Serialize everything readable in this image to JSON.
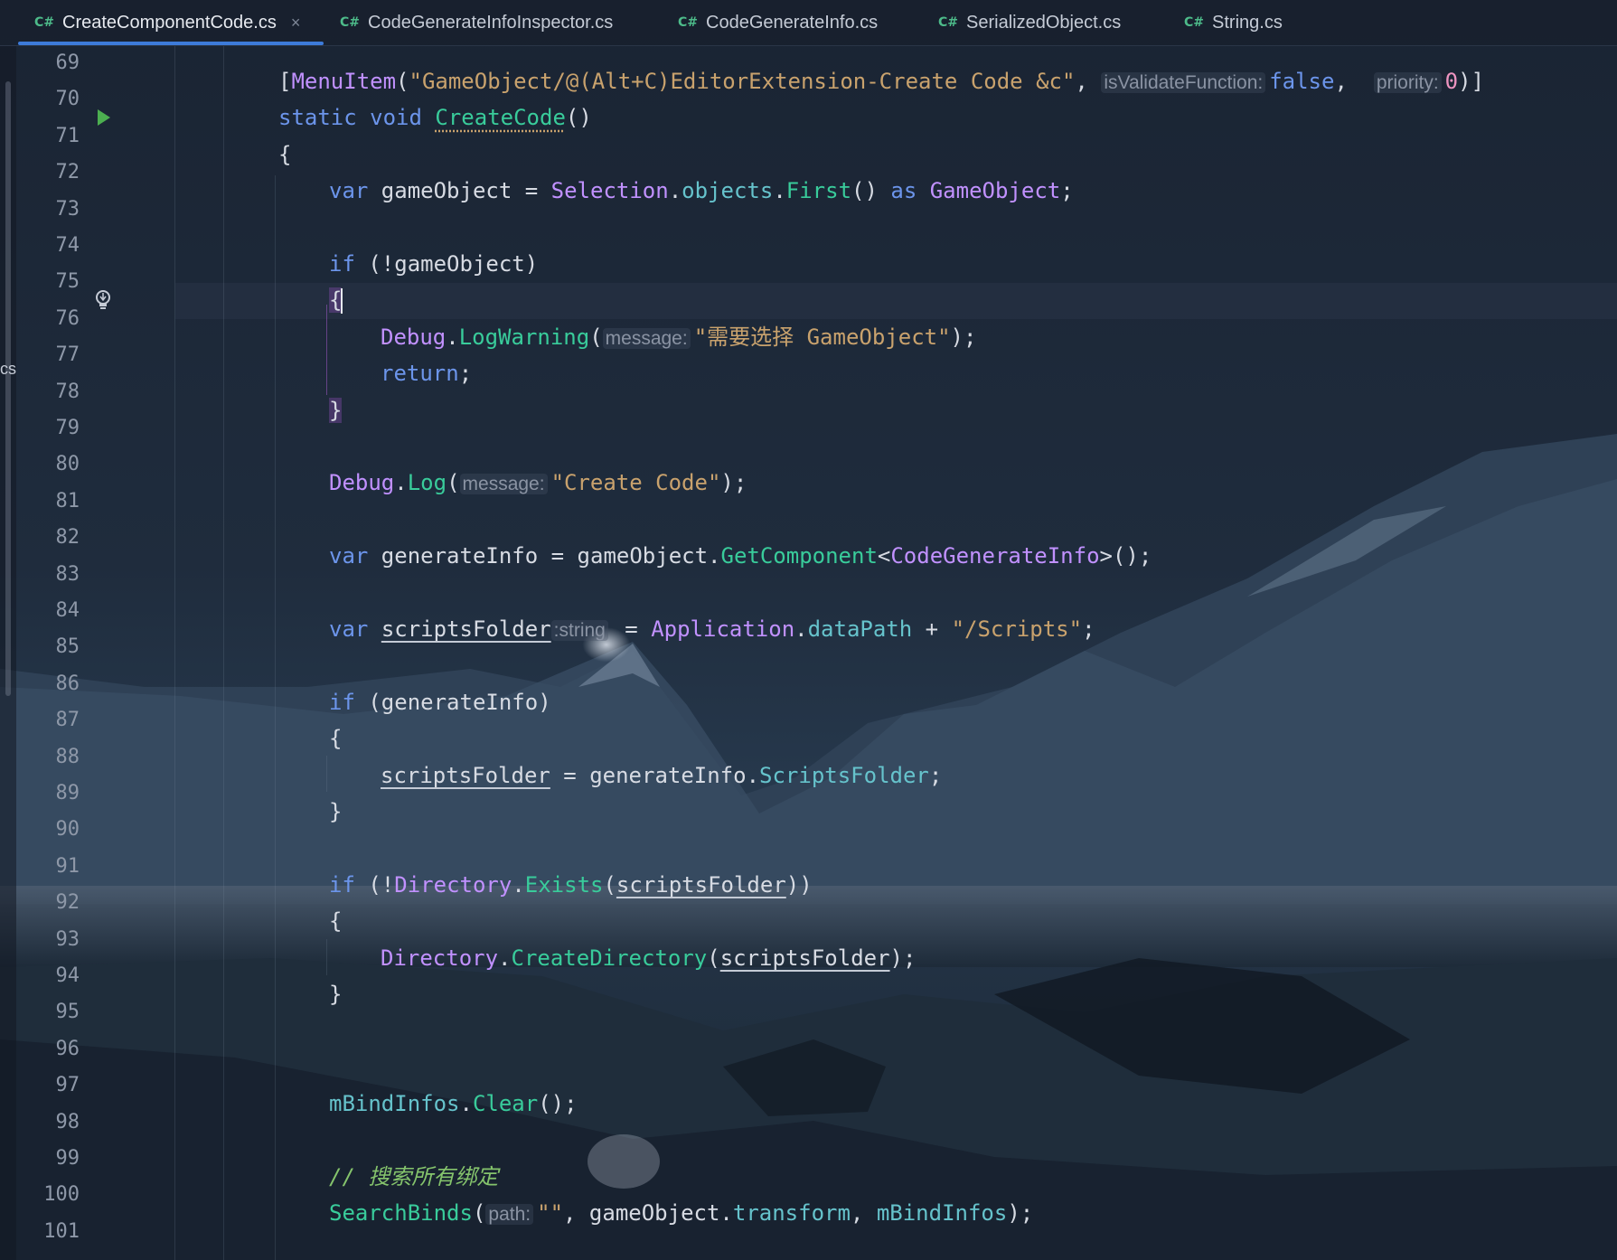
{
  "tabs": [
    {
      "icon": "C#",
      "label": "CreateComponentCode.cs",
      "active": true,
      "close": "×"
    },
    {
      "icon": "C#",
      "label": "CodeGenerateInfoInspector.cs"
    },
    {
      "icon": "C#",
      "label": "CodeGenerateInfo.cs"
    },
    {
      "icon": "C#",
      "label": "SerializedObject.cs"
    },
    {
      "icon": "C#",
      "label": "String.cs"
    }
  ],
  "side_panel_label": "cs",
  "line_numbers": [
    "69",
    "70",
    "71",
    "72",
    "73",
    "74",
    "75",
    "76",
    "77",
    "78",
    "79",
    "80",
    "81",
    "82",
    "83",
    "84",
    "85",
    "86",
    "87",
    "88",
    "89",
    "90",
    "91",
    "92",
    "93",
    "94",
    "95",
    "96",
    "97",
    "98",
    "99",
    "100",
    "101"
  ],
  "code": {
    "l69": {
      "t1": "[",
      "t2": "MenuItem",
      "t3": "(",
      "t4": "\"GameObject/@(Alt+C)EditorExtension-Create Code &c\"",
      "t5": ", ",
      "h1": "isValidateFunction:",
      "t6": "false",
      "t7": ",  ",
      "h2": "priority:",
      "t8": "0",
      "t9": ")]"
    },
    "l70": {
      "t1": "static",
      "t2": " ",
      "t3": "void",
      "t4": " ",
      "t5": "CreateCode",
      "t6": "()"
    },
    "l71": {
      "t1": "{"
    },
    "l72": {
      "t1": "var",
      "t2": " gameObject = ",
      "t3": "Selection",
      "t4": ".",
      "t5": "objects",
      "t6": ".",
      "t7": "First",
      "t8": "() ",
      "t9": "as",
      "t10": " ",
      "t11": "GameObject",
      "t12": ";"
    },
    "l74": {
      "t1": "if",
      "t2": " (!gameObject)"
    },
    "l75": {
      "t1": "{"
    },
    "l76": {
      "t1": "Debug",
      "t2": ".",
      "t3": "LogWarning",
      "t4": "(",
      "h1": "message:",
      "t5": "\"需要选择 GameObject\"",
      "t6": ");"
    },
    "l77": {
      "t1": "return",
      "t2": ";"
    },
    "l78": {
      "t1": "}"
    },
    "l80": {
      "t1": "Debug",
      "t2": ".",
      "t3": "Log",
      "t4": "(",
      "h1": "message:",
      "t5": "\"Create Code\"",
      "t6": ");"
    },
    "l82": {
      "t1": "var",
      "t2": " generateInfo = gameObject.",
      "t3": "GetComponent",
      "t4": "<",
      "t5": "CodeGenerateInfo",
      "t6": ">();"
    },
    "l84": {
      "t1": "var",
      "t2": " ",
      "t3": "scriptsFolder",
      "h1": ":string",
      "t4": " = ",
      "t5": "Application",
      "t6": ".",
      "t7": "dataPath",
      "t8": " + ",
      "t9": "\"/Scripts\"",
      "t10": ";"
    },
    "l86": {
      "t1": "if",
      "t2": " (generateInfo)"
    },
    "l87": {
      "t1": "{"
    },
    "l88": {
      "t1": "scriptsFolder",
      "t2": " = generateInfo.",
      "t3": "ScriptsFolder",
      "t4": ";"
    },
    "l89": {
      "t1": "}"
    },
    "l91": {
      "t1": "if",
      "t2": " (!",
      "t3": "Directory",
      "t4": ".",
      "t5": "Exists",
      "t6": "(",
      "t7": "scriptsFolder",
      "t8": "))"
    },
    "l92": {
      "t1": "{"
    },
    "l93": {
      "t1": "Directory",
      "t2": ".",
      "t3": "CreateDirectory",
      "t4": "(",
      "t5": "scriptsFolder",
      "t6": ");"
    },
    "l94": {
      "t1": "}"
    },
    "l97": {
      "t1": "mBindInfos",
      "t2": ".",
      "t3": "Clear",
      "t4": "();"
    },
    "l99": {
      "t1": "// 搜索所有绑定"
    },
    "l100": {
      "t1": "SearchBinds",
      "t2": "(",
      "h1": "path:",
      "t3": "\"\"",
      "t4": ", gameObject.",
      "t5": "transform",
      "t6": ", ",
      "t7": "mBindInfos",
      "t8": ");"
    }
  },
  "colors": {
    "keyword": "#6c95eb",
    "type": "#c191ff",
    "method": "#39cc9b",
    "string": "#c9a26d",
    "number": "#ed94c0",
    "comment": "#85c46c",
    "accent": "#3d7bd9"
  },
  "icons": {
    "run": "run-gutter-icon",
    "hint": "lightbulb-icon"
  }
}
